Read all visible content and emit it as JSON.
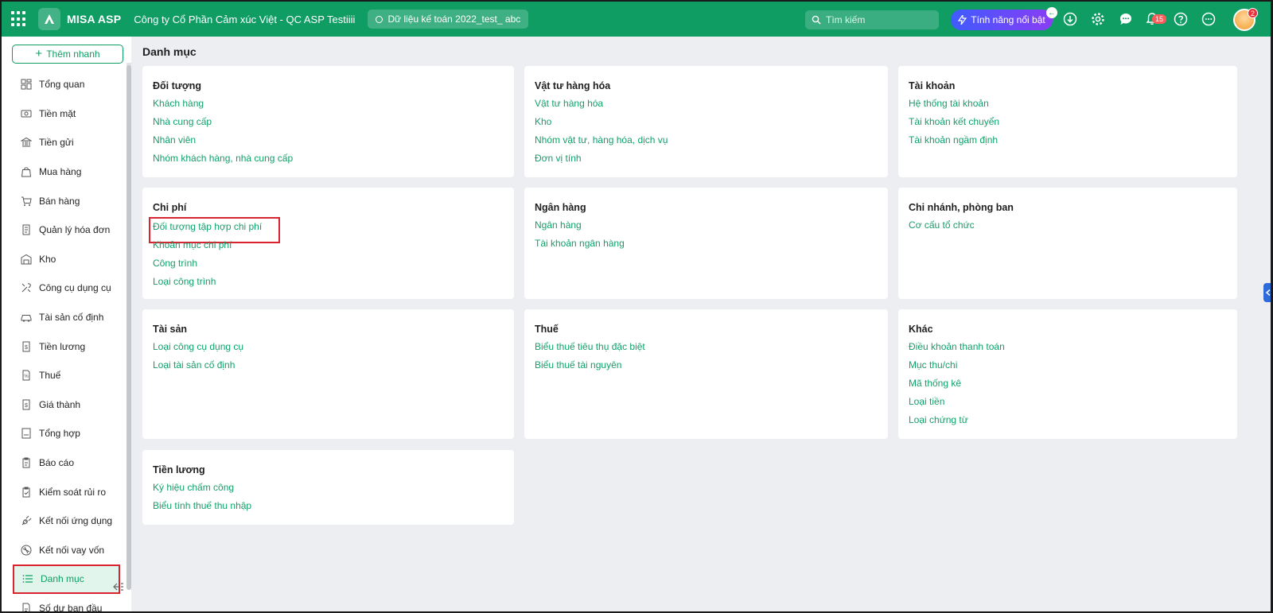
{
  "header": {
    "brand": "MISA ASP",
    "company": "Công ty Cổ Phần Cảm xúc Việt - QC ASP Testiiii",
    "database": "Dữ liệu kế toán 2022_test_ abc",
    "search_placeholder": "Tìm kiếm",
    "feature_label": "Tính năng nổi bật",
    "notif_count": "15",
    "avatar_badge": "2"
  },
  "sidebar": {
    "quick_add_label": "Thêm nhanh",
    "items": [
      {
        "label": "Tổng quan",
        "icon": "dashboard-icon"
      },
      {
        "label": "Tiền mặt",
        "icon": "cash-icon"
      },
      {
        "label": "Tiền gửi",
        "icon": "bank-icon"
      },
      {
        "label": "Mua hàng",
        "icon": "shopping-bag-icon"
      },
      {
        "label": "Bán hàng",
        "icon": "cart-icon"
      },
      {
        "label": "Quản lý hóa đơn",
        "icon": "invoice-icon"
      },
      {
        "label": "Kho",
        "icon": "warehouse-icon"
      },
      {
        "label": "Công cụ dụng cụ",
        "icon": "tools-icon"
      },
      {
        "label": "Tài sản cố định",
        "icon": "car-icon"
      },
      {
        "label": "Tiền lương",
        "icon": "salary-icon"
      },
      {
        "label": "Thuế",
        "icon": "tax-icon"
      },
      {
        "label": "Giá thành",
        "icon": "price-icon"
      },
      {
        "label": "Tổng hợp",
        "icon": "summary-icon"
      },
      {
        "label": "Báo cáo",
        "icon": "report-icon"
      },
      {
        "label": "Kiểm soát rủi ro",
        "icon": "risk-icon"
      },
      {
        "label": "Kết nối ứng dụng",
        "icon": "plug-icon"
      },
      {
        "label": "Kết nối vay vốn",
        "icon": "loan-icon"
      },
      {
        "label": "Danh mục",
        "icon": "list-icon"
      },
      {
        "label": "Số dư ban đầu",
        "icon": "balance-icon"
      }
    ]
  },
  "main": {
    "title": "Danh mục",
    "cards": [
      {
        "title": "Đối tượng",
        "links": [
          "Khách hàng",
          "Nhà cung cấp",
          "Nhân viên",
          "Nhóm khách hàng, nhà cung cấp"
        ]
      },
      {
        "title": "Vật tư hàng hóa",
        "links": [
          "Vật tư hàng hóa",
          "Kho",
          "Nhóm vật tư, hàng hóa, dịch vụ",
          "Đơn vị tính"
        ]
      },
      {
        "title": "Tài khoản",
        "links": [
          "Hệ thống tài khoản",
          "Tài khoản kết chuyển",
          "Tài khoản ngầm định"
        ]
      },
      {
        "title": "Chi phí",
        "links": [
          "Đối tượng tập hợp chi phí",
          "Khoản mục chi phí",
          "Công trình",
          "Loại công trình"
        ]
      },
      {
        "title": "Ngân hàng",
        "links": [
          "Ngân hàng",
          "Tài khoản ngân hàng"
        ]
      },
      {
        "title": "Chi nhánh, phòng ban",
        "links": [
          "Cơ cấu tổ chức"
        ]
      },
      {
        "title": "Tài sản",
        "links": [
          "Loại công cụ dụng cụ",
          "Loại tài sản cố định"
        ]
      },
      {
        "title": "Thuế",
        "links": [
          "Biểu thuế tiêu thụ đặc biệt",
          "Biểu thuế tài nguyên"
        ]
      },
      {
        "title": "Khác",
        "links": [
          "Điều khoản thanh toán",
          "Mục thu/chi",
          "Mã thống kê",
          "Loại tiền",
          "Loại chứng từ"
        ]
      },
      {
        "title": "Tiền lương",
        "links": [
          "Ký hiệu chấm công",
          "Biểu tính thuế thu nhập"
        ]
      }
    ]
  },
  "colors": {
    "primary": "#0f9d64",
    "link": "#13a06a",
    "highlight": "#d9232e"
  }
}
